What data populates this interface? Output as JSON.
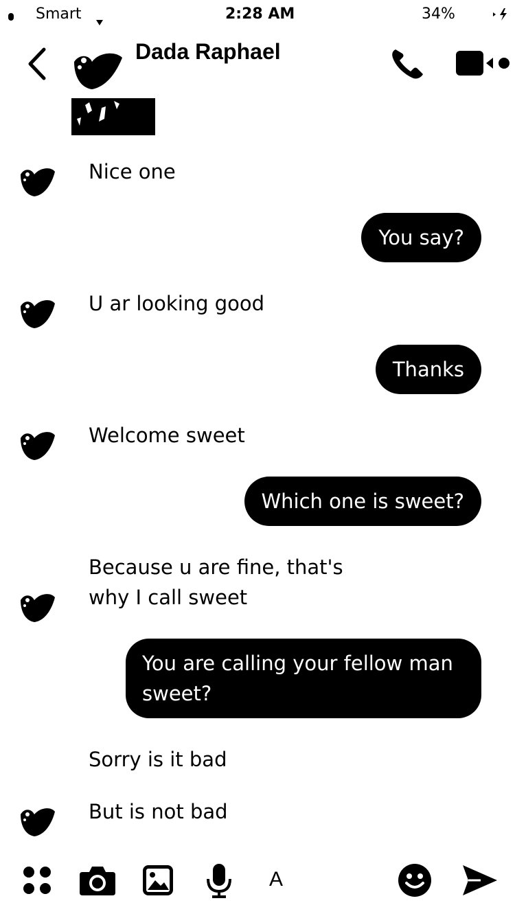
{
  "status_bar": {
    "carrier": "Smart",
    "time": "2:28 AM",
    "battery": "34%"
  },
  "header": {
    "contact_name": "Dada Raphael",
    "back_icon": "chevron-left-icon",
    "call_icon": "phone-icon",
    "video_icon": "video-camera-icon"
  },
  "messages": [
    {
      "dir": "in",
      "text": "Nice one"
    },
    {
      "dir": "out",
      "text": "You say?"
    },
    {
      "dir": "in",
      "text": "U ar looking good"
    },
    {
      "dir": "out",
      "text": "Thanks"
    },
    {
      "dir": "in",
      "text": "Welcome sweet"
    },
    {
      "dir": "out",
      "text": "Which one is sweet?"
    },
    {
      "dir": "in",
      "text": "Because u are fine, that's\nwhy I call sweet"
    },
    {
      "dir": "out",
      "text": "You are calling your fellow man\nsweet?"
    },
    {
      "dir": "in",
      "text": "Sorry is it bad"
    },
    {
      "dir": "in",
      "text": "But is not bad"
    }
  ],
  "composer": {
    "text_label": "A",
    "icons": [
      "apps-icon",
      "camera-icon",
      "image-icon",
      "microphone-icon",
      "emoji-icon",
      "send-icon"
    ]
  },
  "colors": {
    "background": "#ffffff",
    "bubble_out": "#000000",
    "text": "#000000"
  }
}
